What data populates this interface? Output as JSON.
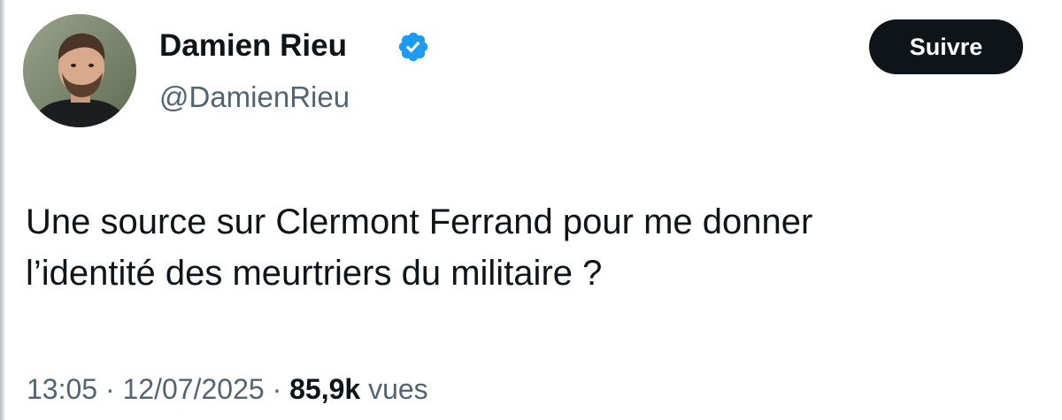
{
  "author": {
    "display_name": "Damien Rieu",
    "handle": "@DamienRieu",
    "verified": true,
    "avatar_icon": "profile-photo"
  },
  "follow_button": {
    "label": "Suivre"
  },
  "tweet": {
    "text_lines": [
      "Une source sur Clermont Ferrand pour me donner",
      "l’identité des meurtriers du militaire ?"
    ],
    "time": "13:05",
    "date": "12/07/2025",
    "separator": " · ",
    "views_count": "85,9k",
    "views_label": "vues"
  },
  "colors": {
    "text_primary": "#0f1419",
    "text_secondary": "#536471",
    "verified_badge": "#1d9bf0",
    "follow_button_bg": "#0f1419",
    "follow_button_text": "#ffffff"
  }
}
